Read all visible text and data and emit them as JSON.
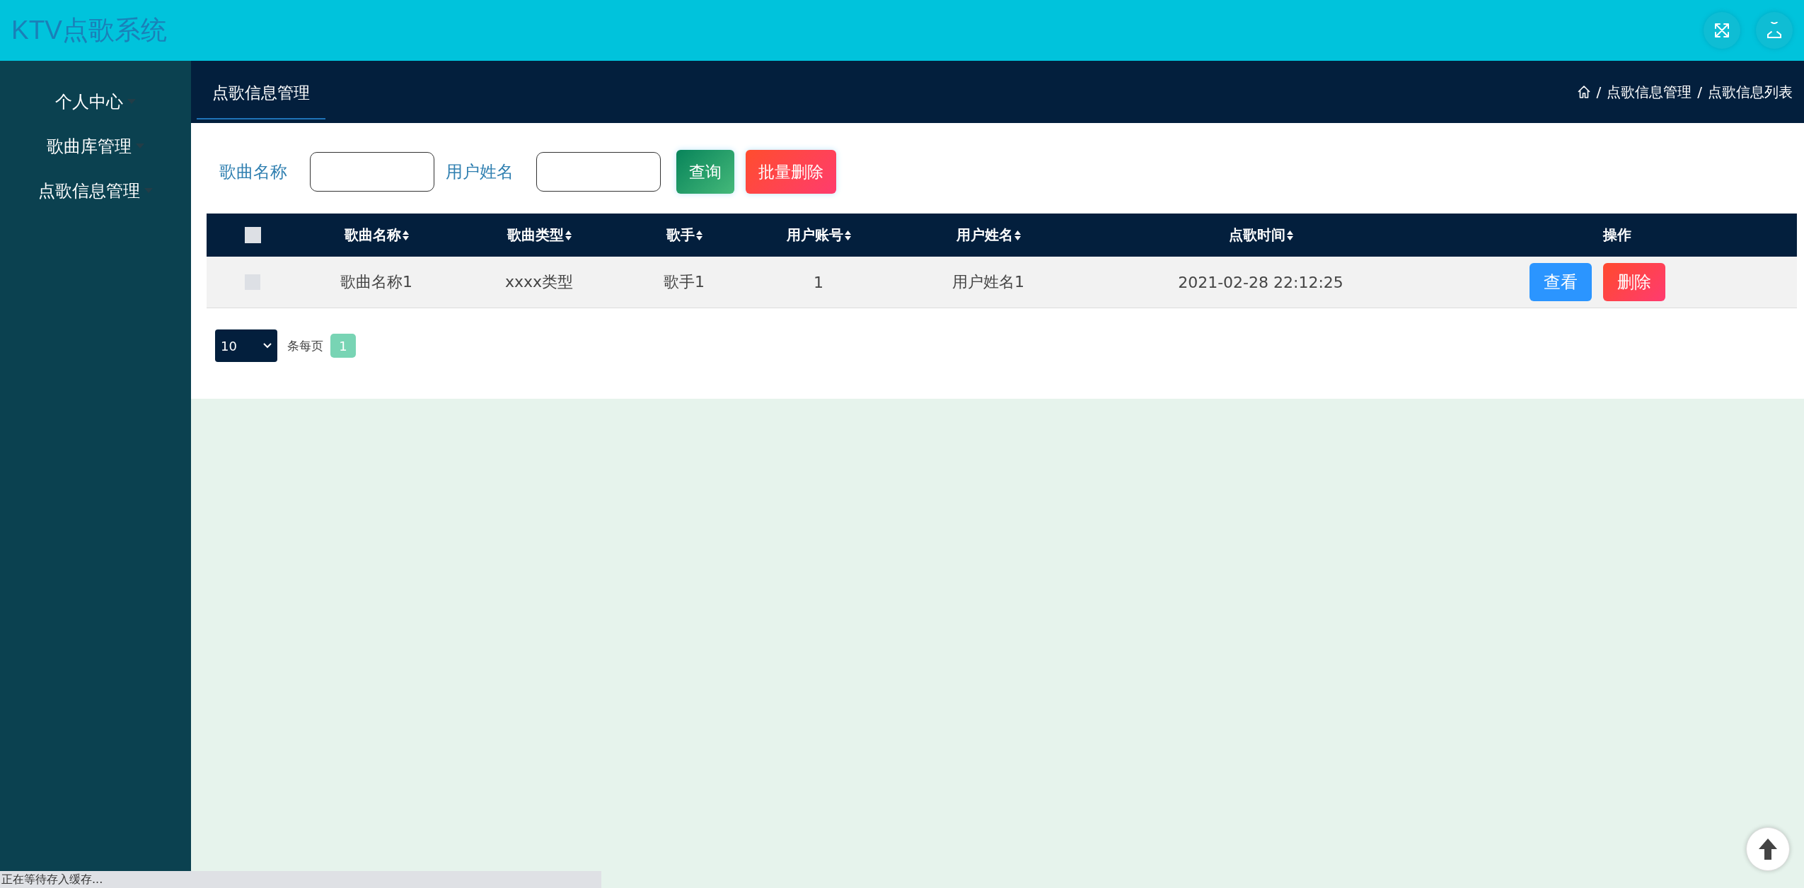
{
  "header": {
    "title": "KTV点歌系统"
  },
  "sidebar": {
    "items": [
      {
        "label": "个人中心"
      },
      {
        "label": "歌曲库管理"
      },
      {
        "label": "点歌信息管理"
      }
    ]
  },
  "subheader": {
    "tab": {
      "label": "点歌信息管理",
      "selected": true
    },
    "breadcrumb": {
      "separator": "/",
      "items": [
        "点歌信息管理",
        "点歌信息列表"
      ]
    }
  },
  "filters": [
    {
      "label": "歌曲名称"
    },
    {
      "label": "用户姓名"
    }
  ],
  "filter_buttons": [
    {
      "label": "查询",
      "kind": "query"
    },
    {
      "label": "批量删除",
      "kind": "danger"
    }
  ],
  "table": {
    "select_all": {
      "checked": false
    },
    "columns": [
      {
        "label": "歌曲名称",
        "sortable": true
      },
      {
        "label": "歌曲类型",
        "sortable": true
      },
      {
        "label": "歌手",
        "sortable": true
      },
      {
        "label": "用户账号",
        "sortable": true
      },
      {
        "label": "用户姓名",
        "sortable": true
      },
      {
        "label": "点歌时间",
        "sortable": true
      },
      {
        "label": "操作",
        "sortable": false
      }
    ],
    "rows": [
      {
        "checked": false,
        "cells": [
          "歌曲名称1",
          "xxxx类型",
          "歌手1",
          "1",
          "用户姓名1",
          "2021-02-28 22:12:25"
        ],
        "actions": [
          {
            "label": "查看",
            "kind": "view"
          },
          {
            "label": "删除",
            "kind": "delete"
          }
        ]
      }
    ]
  },
  "pagination": {
    "page_size": "10",
    "per_page_label": "条每页",
    "pages": [
      {
        "label": "1",
        "selected": true
      }
    ]
  },
  "status_bar": "正在等待存入缓存..."
}
